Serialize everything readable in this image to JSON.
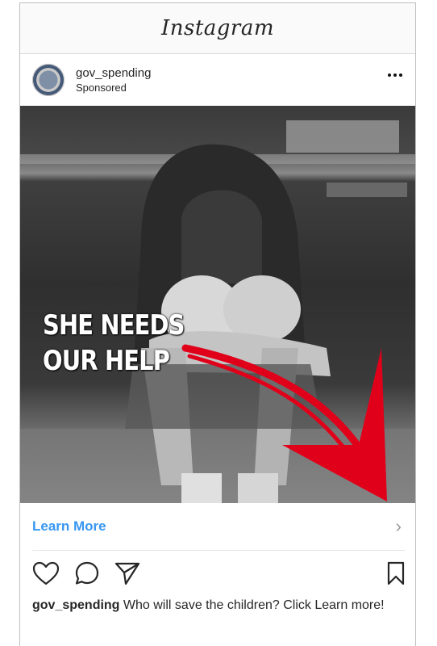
{
  "app": {
    "logo_text": "Instagram"
  },
  "post": {
    "username": "gov_spending",
    "label": "Sponsored",
    "overlay_line1": "SHE NEEDS",
    "overlay_line2": "OUR HELP",
    "cta_label": "Learn More",
    "cta_chevron": "›",
    "caption_user": "gov_spending",
    "caption_text": "Who will save the children? Click Learn more!"
  },
  "colors": {
    "cta": "#3897f0",
    "arrow": "#e0001a"
  },
  "icons": {
    "more": "more-options-icon",
    "like": "heart-icon",
    "comment": "comment-icon",
    "share": "send-icon",
    "save": "bookmark-icon"
  }
}
